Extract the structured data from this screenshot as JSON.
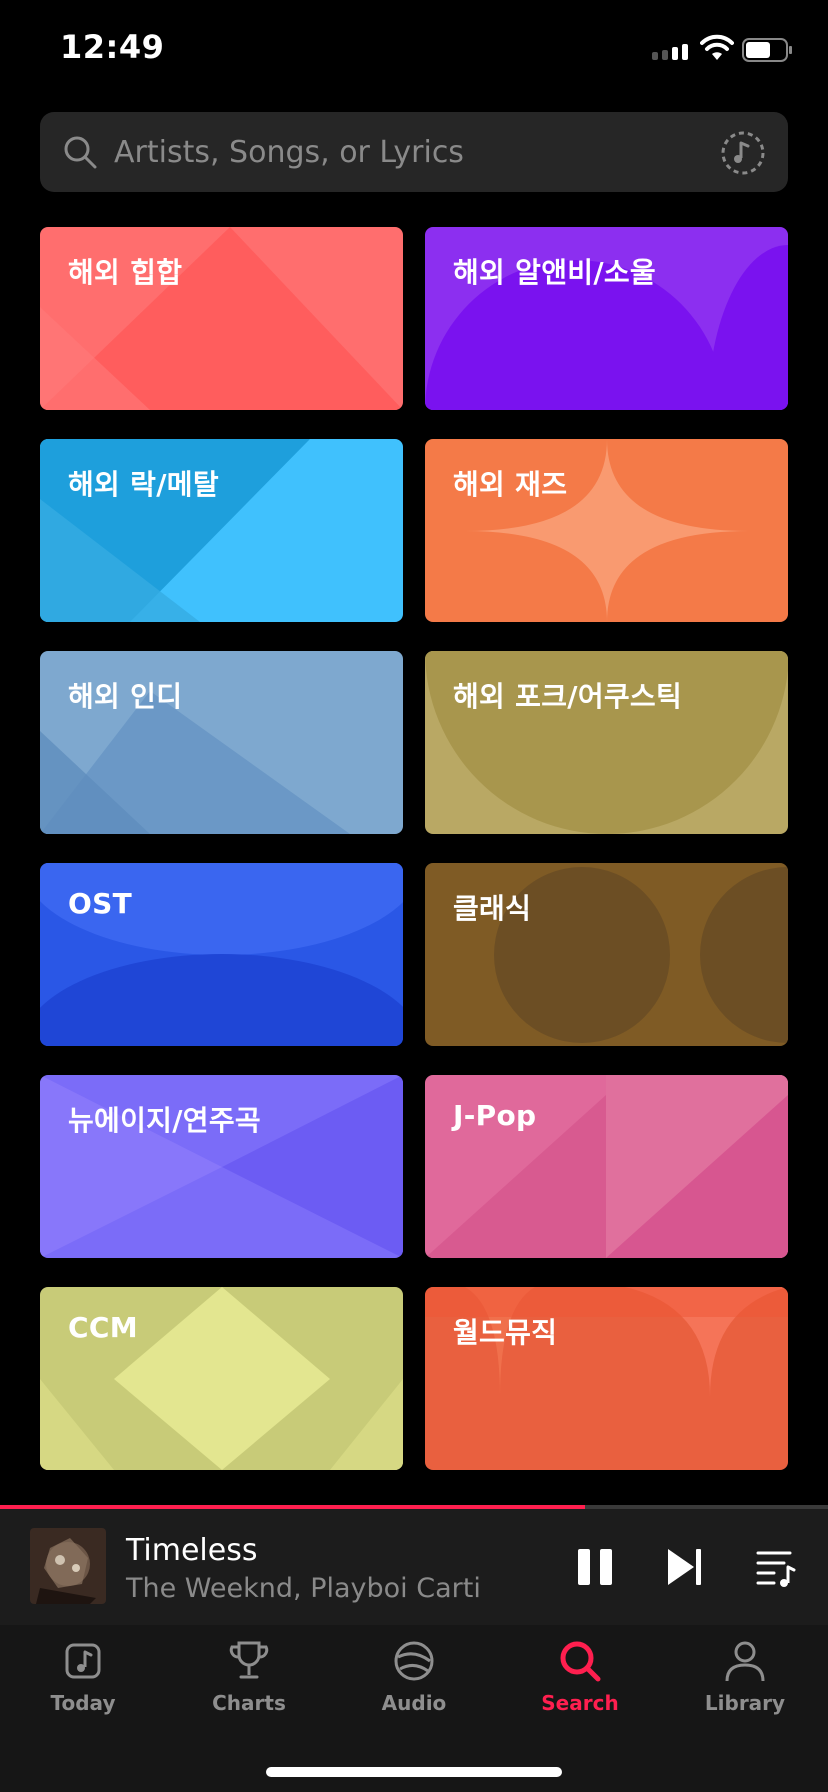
{
  "status_bar": {
    "time": "12:49"
  },
  "search": {
    "placeholder": "Artists, Songs, or Lyrics"
  },
  "genres": [
    {
      "label": "해외 힙합",
      "color": "#ff6b6b"
    },
    {
      "label": "해외 알앤비/소울",
      "color": "#8a1cf5"
    },
    {
      "label": "해외 락/메탈",
      "color": "#2aa6e6"
    },
    {
      "label": "해외 재즈",
      "color": "#f5794a"
    },
    {
      "label": "해외 인디",
      "color": "#7aa7d0"
    },
    {
      "label": "해외 포크/어쿠스틱",
      "color": "#b7a660"
    },
    {
      "label": "OST",
      "color": "#2550e0"
    },
    {
      "label": "클래식",
      "color": "#7d5a28"
    },
    {
      "label": "뉴에이지/연주곡",
      "color": "#7b68f7"
    },
    {
      "label": "J-Pop",
      "color": "#e0679a"
    },
    {
      "label": "CCM",
      "color": "#d6d880"
    },
    {
      "label": "월드뮤직",
      "color": "#ee5b3c"
    }
  ],
  "now_playing": {
    "title": "Timeless",
    "artist": "The Weeknd, Playboi Carti",
    "progress": 0.707
  },
  "tabs": [
    {
      "label": "Today",
      "icon": "music-note-icon"
    },
    {
      "label": "Charts",
      "icon": "trophy-icon"
    },
    {
      "label": "Audio",
      "icon": "globe-icon"
    },
    {
      "label": "Search",
      "icon": "search-icon",
      "active": true
    },
    {
      "label": "Library",
      "icon": "person-icon"
    }
  ],
  "colors": {
    "accent": "#ff1f4f",
    "background": "#000000"
  }
}
